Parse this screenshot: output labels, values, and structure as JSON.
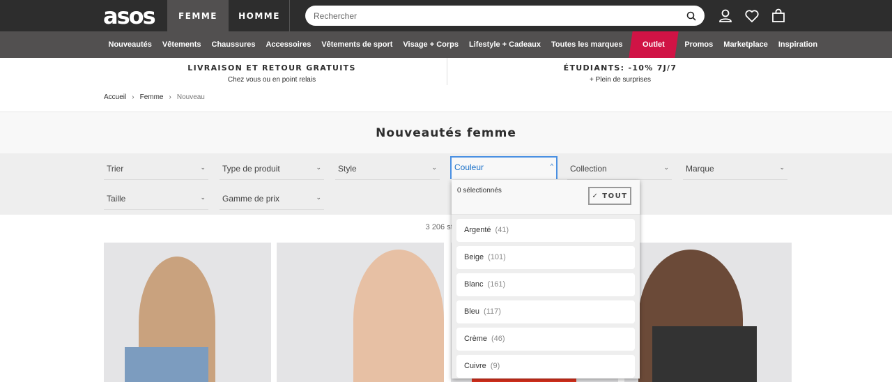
{
  "header": {
    "logo": "asos",
    "tabs": [
      "FEMME",
      "HOMME"
    ],
    "search_placeholder": "Rechercher"
  },
  "nav": [
    "Nouveautés",
    "Vêtements",
    "Chaussures",
    "Accessoires",
    "Vêtements de sport",
    "Visage + Corps",
    "Lifestyle + Cadeaux",
    "Toutes les marques",
    "Outlet",
    "Promos",
    "Marketplace",
    "Inspiration"
  ],
  "promo": [
    {
      "title": "LIVRAISON ET RETOUR GRATUITS",
      "sub": "Chez vous ou en point relais"
    },
    {
      "title": "ÉTUDIANTS: -10% 7J/7",
      "sub": "+ Plein de surprises"
    }
  ],
  "breadcrumb": [
    "Accueil",
    "Femme",
    "Nouveau"
  ],
  "page_title": "Nouveautés femme",
  "filters": [
    "Trier",
    "Type de produit",
    "Style",
    "Couleur",
    "Collection",
    "Marque",
    "Taille",
    "Gamme de prix"
  ],
  "count": "3 206 styles",
  "dropdown": {
    "selected": "0 sélectionnés",
    "all_label": "✓ TOUT",
    "options": [
      {
        "name": "Argenté",
        "count": "(41)"
      },
      {
        "name": "Beige",
        "count": "(101)"
      },
      {
        "name": "Blanc",
        "count": "(161)"
      },
      {
        "name": "Bleu",
        "count": "(117)"
      },
      {
        "name": "Crème",
        "count": "(46)"
      },
      {
        "name": "Cuivre",
        "count": "(9)"
      }
    ]
  }
}
